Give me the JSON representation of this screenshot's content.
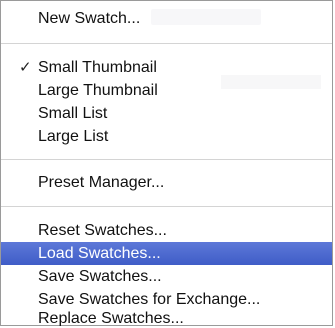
{
  "menu": {
    "groups": [
      {
        "items": [
          {
            "label": "New Swatch...",
            "checked": false,
            "highlighted": false
          }
        ]
      },
      {
        "items": [
          {
            "label": "Small Thumbnail",
            "checked": true,
            "highlighted": false
          },
          {
            "label": "Large Thumbnail",
            "checked": false,
            "highlighted": false
          },
          {
            "label": "Small List",
            "checked": false,
            "highlighted": false
          },
          {
            "label": "Large List",
            "checked": false,
            "highlighted": false
          }
        ]
      },
      {
        "items": [
          {
            "label": "Preset Manager...",
            "checked": false,
            "highlighted": false
          }
        ]
      },
      {
        "items": [
          {
            "label": "Reset Swatches...",
            "checked": false,
            "highlighted": false
          },
          {
            "label": "Load Swatches...",
            "checked": false,
            "highlighted": true
          },
          {
            "label": "Save Swatches...",
            "checked": false,
            "highlighted": false
          },
          {
            "label": "Save Swatches for Exchange...",
            "checked": false,
            "highlighted": false
          },
          {
            "label": "Replace Swatches...",
            "checked": false,
            "highlighted": false
          }
        ]
      }
    ],
    "check_glyph": "✓",
    "highlight_color": "#4a68cf"
  }
}
